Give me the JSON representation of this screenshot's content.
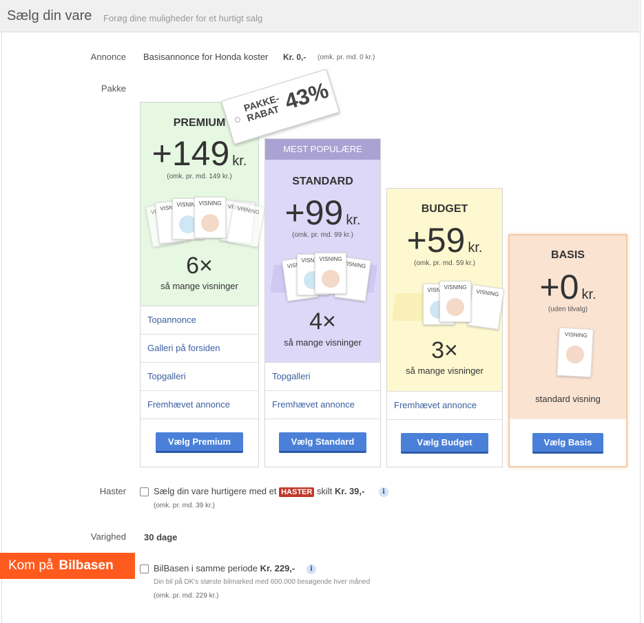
{
  "header": {
    "title": "Sælg din vare",
    "subtitle": "Forøg dine muligheder for et hurtigt salg"
  },
  "annonce": {
    "label": "Annonce",
    "text": "Basisannonce for Honda koster",
    "price": "Kr. 0,-",
    "permd": "(omk. pr. md. 0 kr.)"
  },
  "pakke": {
    "label": "Pakke"
  },
  "tag": {
    "line1": "PAKKE-",
    "line2": "RABAT",
    "percent": "43%"
  },
  "packages": {
    "premium": {
      "name": "PREMIUM",
      "price": "+149",
      "kr": "kr.",
      "permd": "(omk. pr. md. 149 kr.)",
      "mult": "6×",
      "multtext": "så mange visninger",
      "features": [
        "Topannonce",
        "Galleri på forsiden",
        "Topgalleri",
        "Fremhævet annonce"
      ],
      "button": "Vælg Premium",
      "bg": "#e6f7e2"
    },
    "standard": {
      "ribbon": "MEST POPULÆRE",
      "name": "STANDARD",
      "price": "+99",
      "kr": "kr.",
      "permd": "(omk. pr. md. 99 kr.)",
      "mult": "4×",
      "multtext": "så mange visninger",
      "features": [
        "Topgalleri",
        "Fremhævet annonce"
      ],
      "button": "Vælg Standard",
      "bg": "#ddd8f7"
    },
    "budget": {
      "name": "BUDGET",
      "price": "+59",
      "kr": "kr.",
      "permd": "(omk. pr. md. 59 kr.)",
      "mult": "3×",
      "multtext": "så mange visninger",
      "features": [
        "Fremhævet annonce"
      ],
      "button": "Vælg Budget",
      "bg": "#fdf8cf"
    },
    "basis": {
      "name": "BASIS",
      "price": "+0",
      "kr": "kr.",
      "permd": "(uden tilvalg)",
      "multtext": "standard visning",
      "button": "Vælg Basis",
      "bg": "#fbe3d2"
    }
  },
  "visning": "VISNING",
  "haster": {
    "label": "Haster",
    "pre": "Sælg din vare hurtigere med et",
    "badge": "HASTER",
    "post": "skilt",
    "price": "Kr. 39,-",
    "permd": "(omk. pr. md. 39 kr.)"
  },
  "varighed": {
    "label": "Varighed",
    "value": "30 dage"
  },
  "bilbasen": {
    "banner_pre": "Kom på",
    "banner_brand": "Bilbasen",
    "text": "BilBasen i samme periode",
    "price": "Kr. 229,-",
    "desc": "Din bil på DK's største bilmarked med 600.000 besøgende hver måned",
    "permd": "(omk. pr. md. 229 kr.)"
  },
  "colors": {
    "button": "#4a80d8",
    "link": "#3a5fa0",
    "banner": "#ff5a1e",
    "haster": "#c0392b"
  }
}
